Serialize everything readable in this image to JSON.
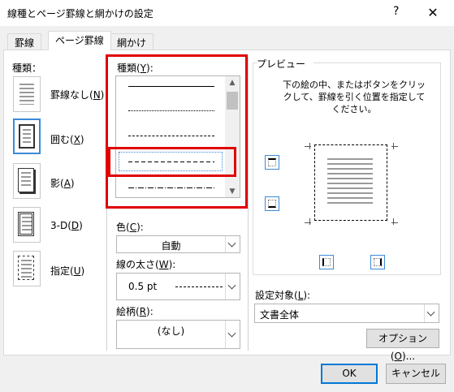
{
  "window": {
    "title": "線種とページ罫線と網かけの設定",
    "help": "?",
    "close": "✕"
  },
  "tabs": [
    {
      "label": "罫線",
      "active": false
    },
    {
      "label": "ページ罫線",
      "active": true
    },
    {
      "label": "網かけ",
      "active": false
    }
  ],
  "settings": {
    "group_label": "種類：",
    "items": [
      {
        "label": "罫線なし(",
        "key": "N",
        "tail": ")",
        "selected": false
      },
      {
        "label": "囲む(",
        "key": "X",
        "tail": ")",
        "selected": true
      },
      {
        "label": "影(",
        "key": "A",
        "tail": ")",
        "selected": false
      },
      {
        "label": "3-D(",
        "key": "D",
        "tail": ")",
        "selected": false
      },
      {
        "label": "指定(",
        "key": "U",
        "tail": ")",
        "selected": false
      }
    ]
  },
  "style": {
    "label": "種類(",
    "key": "Y",
    "tail": "):",
    "line_styles": [
      "solid",
      "dotted",
      "dashed-fine",
      "dashed",
      "dash-dot"
    ],
    "selected_index": 3
  },
  "color": {
    "label": "色(",
    "key": "C",
    "tail": "):",
    "value": "自動"
  },
  "width": {
    "label": "線の太さ(",
    "key": "W",
    "tail": "):",
    "value": "0.5 pt"
  },
  "art": {
    "label": "絵柄(",
    "key": "R",
    "tail": "):",
    "value": "(なし)"
  },
  "preview": {
    "label": "プレビュー",
    "instruction": "下の絵の中、またはボタンをクリックして、罫線を引く位置を指定してください。"
  },
  "apply_to": {
    "label": "設定対象(",
    "key": "L",
    "tail": "):",
    "value": "文書全体"
  },
  "buttons": {
    "options": "オプション(",
    "options_key": "O",
    "options_tail": ")...",
    "ok": "OK",
    "cancel": "キャンセル"
  },
  "colors": {
    "highlight": "#e00000",
    "accent": "#0078d7",
    "selected_icon": "#3c8ad6"
  }
}
